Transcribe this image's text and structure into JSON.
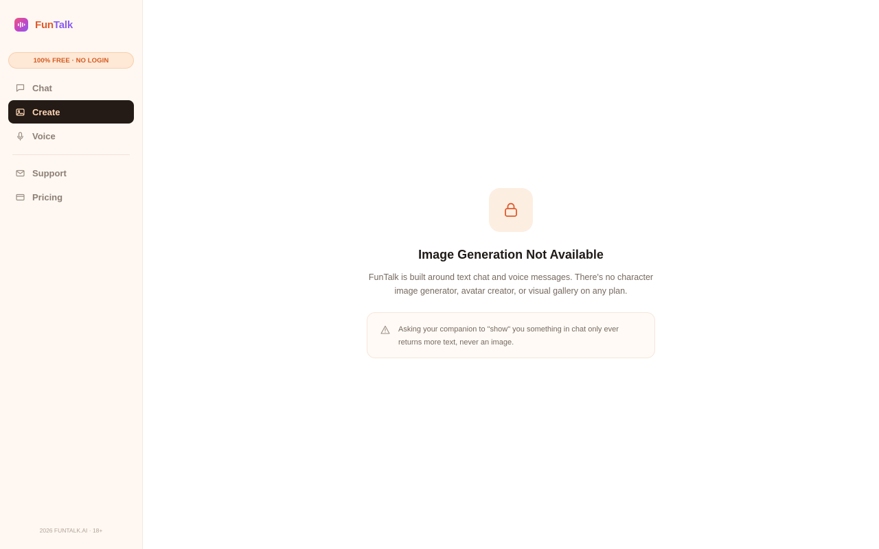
{
  "brand": {
    "name_part1": "Fun",
    "name_part2": "Talk",
    "logo_icon": "audio-wave-icon"
  },
  "badge": "100% FREE · NO LOGIN",
  "nav": {
    "primary": [
      {
        "label": "Chat",
        "icon": "chat-icon",
        "active": false
      },
      {
        "label": "Create",
        "icon": "image-icon",
        "active": true
      },
      {
        "label": "Voice",
        "icon": "microphone-icon",
        "active": false
      }
    ],
    "secondary": [
      {
        "label": "Support",
        "icon": "mail-icon"
      },
      {
        "label": "Pricing",
        "icon": "credit-card-icon"
      }
    ]
  },
  "footer": "2026 FUNTALK.AI · 18+",
  "main": {
    "icon": "lock-icon",
    "title": "Image Generation Not Available",
    "description": "FunTalk is built around text chat and voice messages. There's no character image generator, avatar creator, or visual gallery on any plan.",
    "note": "Asking your companion to \"show\" you something in chat only ever returns more text, never an image.",
    "note_icon": "warning-icon"
  },
  "colors": {
    "accent": "#e15a2b",
    "brand_purple": "#8a5cf0",
    "active_nav_bg": "#241a16",
    "active_nav_text": "#fbd5b4",
    "sidebar_bg": "#fff8f2"
  }
}
